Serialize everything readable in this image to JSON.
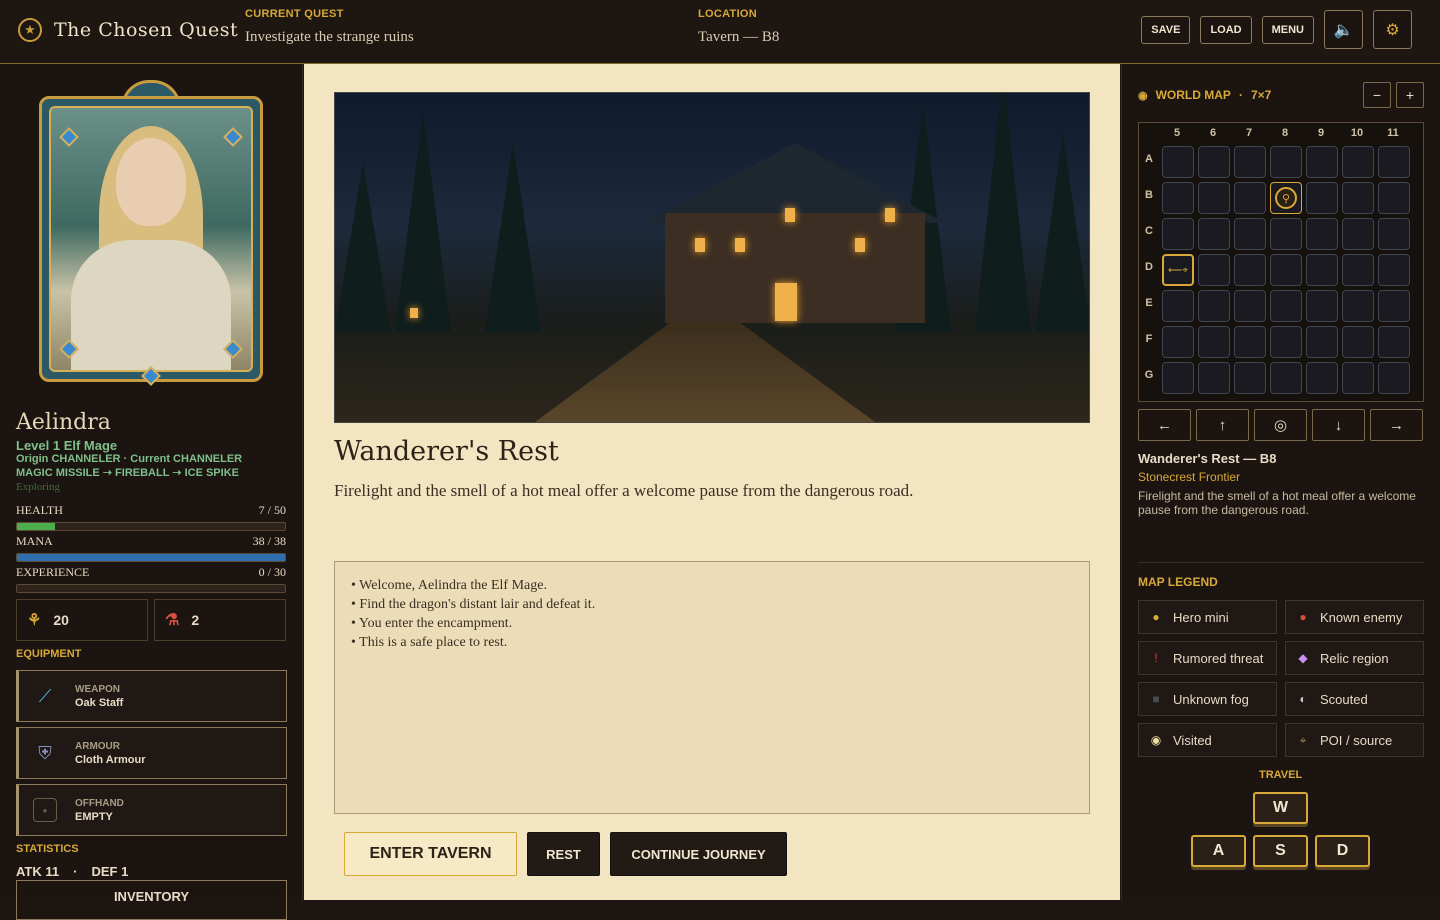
{
  "header": {
    "title": "The Chosen Quest",
    "quest_label": "CURRENT QUEST",
    "quest_value": "Investigate the strange ruins",
    "location_label": "LOCATION",
    "location_value": "Tavern — B8",
    "save": "SAVE",
    "load": "LOAD",
    "menu": "MENU",
    "icons": [
      "star-icon",
      "speaker-icon",
      "gear-icon"
    ]
  },
  "hero": {
    "name": "Aelindra",
    "level": "Level 1 Elf Mage",
    "origin": "Origin CHANNELER · Current CHANNELER",
    "spells": "MAGIC MISSILE ➝ FIREBALL ➝ ICE SPIKE",
    "state": "Exploring",
    "health_label": "HEALTH",
    "health_text": "7 / 50",
    "health": {
      "current": 7,
      "max": 50
    },
    "mana_label": "MANA",
    "mana_text": "38 / 38",
    "mana": {
      "current": 38,
      "max": 38
    },
    "xp_label": "EXPERIENCE",
    "xp_text": "0 / 30",
    "xp": {
      "current": 0,
      "max": 30
    },
    "gold": "20",
    "potions": "2",
    "equipment_label": "EQUIPMENT",
    "equipment": [
      {
        "slot": "WEAPON",
        "item": "Oak Staff",
        "icon": "staff-icon"
      },
      {
        "slot": "ARMOUR",
        "item": "Cloth Armour",
        "icon": "armour-icon"
      },
      {
        "slot": "OFFHAND",
        "item": "EMPTY",
        "icon": "empty-slot-icon"
      }
    ],
    "statistics_label": "STATISTICS",
    "atk": "ATK 11",
    "sep": "·",
    "def": "DEF 1",
    "inventory": "INVENTORY"
  },
  "scene": {
    "title": "Wanderer's Rest",
    "description": "Firelight and the smell of a hot meal offer a welcome pause from the dangerous road.",
    "log": [
      "• Welcome, Aelindra the Elf Mage.",
      "• Find the dragon's distant lair and defeat it.",
      "• You enter the encampment.",
      "• This is a safe place to rest."
    ],
    "actions": [
      "ENTER TAVERN",
      "REST",
      "CONTINUE JOURNEY"
    ]
  },
  "map": {
    "title": "WORLD MAP",
    "sep": "·",
    "size": "7×7",
    "zoom_out": "−",
    "zoom_in": "+",
    "columns": [
      "5",
      "6",
      "7",
      "8",
      "9",
      "10",
      "11"
    ],
    "rows": [
      "A",
      "B",
      "C",
      "D",
      "E",
      "F",
      "G"
    ],
    "hero_cell": "B8",
    "poi_cell": "D5",
    "directions": [
      "←",
      "↑",
      "◎",
      "↓",
      "→"
    ],
    "current_name": "Wanderer's Rest — B8",
    "current_region": "Stonecrest Frontier",
    "current_desc": "Firelight and the smell of a hot meal offer a welcome pause from the dangerous road.",
    "legend_label": "MAP LEGEND",
    "legend": [
      {
        "label": "Hero mini",
        "symbol": "●",
        "color": "#d8a938"
      },
      {
        "label": "Known enemy",
        "symbol": "●",
        "color": "#d2503c"
      },
      {
        "label": "Rumored threat",
        "symbol": "!",
        "color": "#e04030"
      },
      {
        "label": "Relic region",
        "symbol": "◆",
        "color": "#c890f0"
      },
      {
        "label": "Unknown fog",
        "symbol": "■",
        "color": "#4a4a52"
      },
      {
        "label": "Scouted",
        "symbol": "◐",
        "color": "#c8c8d0"
      },
      {
        "label": "Visited",
        "symbol": "◉",
        "color": "#f0e0a0"
      },
      {
        "label": "POI / source",
        "symbol": "⌖",
        "color": "#a08a5c"
      }
    ],
    "travel_label": "TRAVEL",
    "keys": [
      "W",
      "A",
      "S",
      "D"
    ]
  },
  "colors": {
    "accent": "#d8a938",
    "health": "#4cae4c",
    "mana": "#2f6fb0",
    "parchment": "#f3e5c2"
  }
}
